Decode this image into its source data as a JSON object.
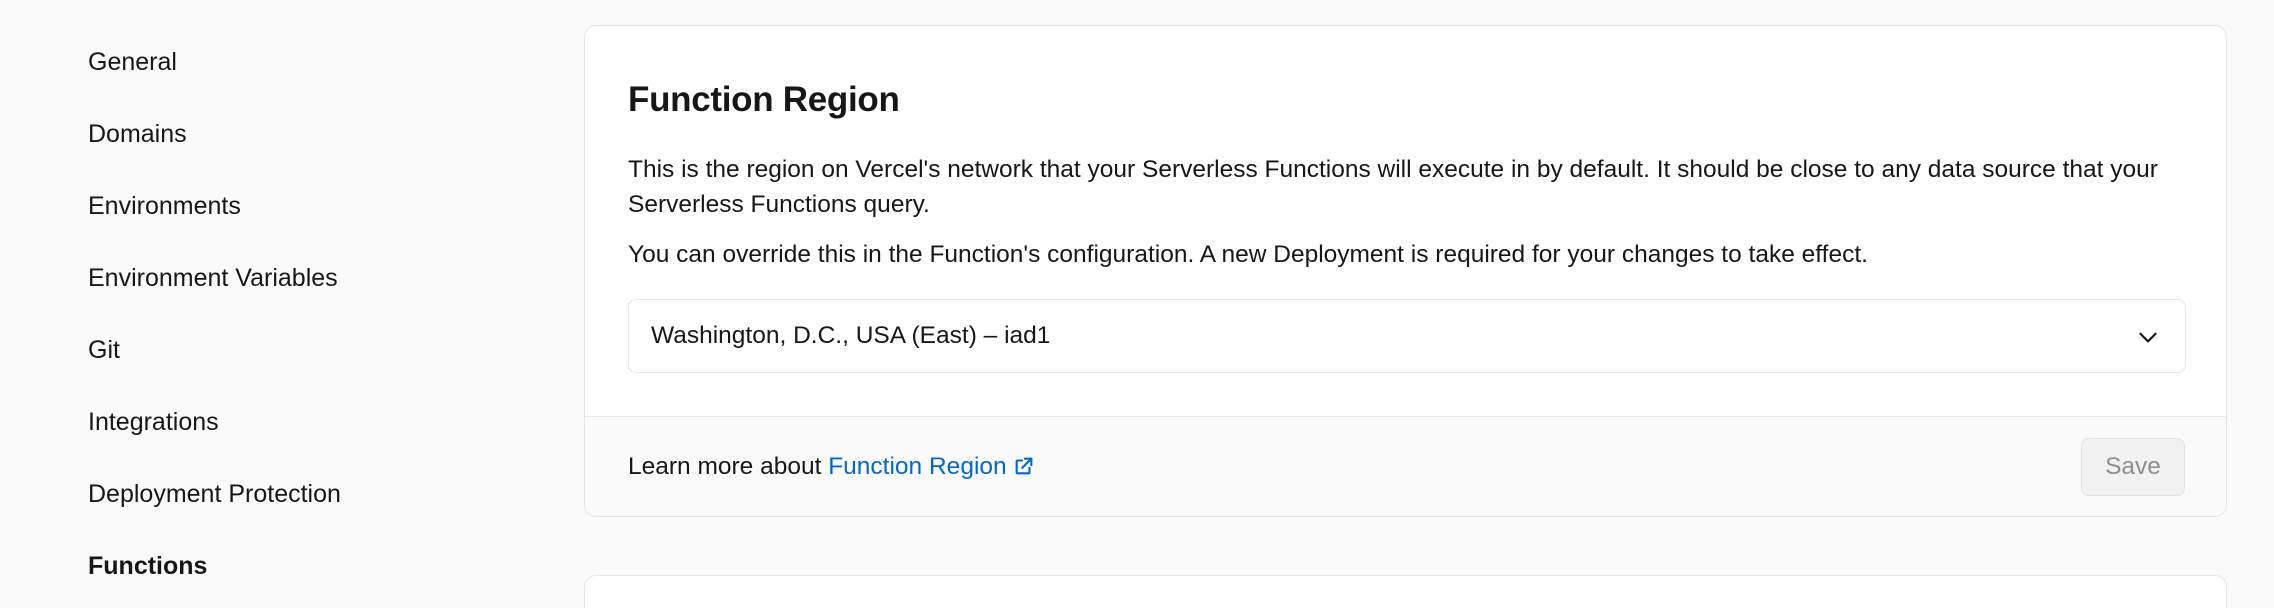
{
  "sidebar": {
    "items": [
      {
        "label": "General"
      },
      {
        "label": "Domains"
      },
      {
        "label": "Environments"
      },
      {
        "label": "Environment Variables"
      },
      {
        "label": "Git"
      },
      {
        "label": "Integrations"
      },
      {
        "label": "Deployment Protection"
      },
      {
        "label": "Functions",
        "active": true
      }
    ]
  },
  "function_region": {
    "title": "Function Region",
    "description_1": "This is the region on Vercel's network that your Serverless Functions will execute in by default. It should be close to any data source that your Serverless Functions query.",
    "description_2": "You can override this in the Function's configuration. A new Deployment is required for your changes to take effect.",
    "select": {
      "selected_value": "Washington, D.C., USA (East) – iad1",
      "icon": "chevron-down-icon"
    },
    "footer": {
      "learn_prefix": "Learn more about",
      "learn_link": "Function Region",
      "link_icon": "external-link-icon",
      "save_label": "Save"
    }
  },
  "colors": {
    "link": "#0068d6",
    "text": "#171717",
    "background": "#fafafa",
    "card": "#ffffff",
    "border": "#e5e5e5",
    "disabled_text": "#8f8f8f"
  }
}
